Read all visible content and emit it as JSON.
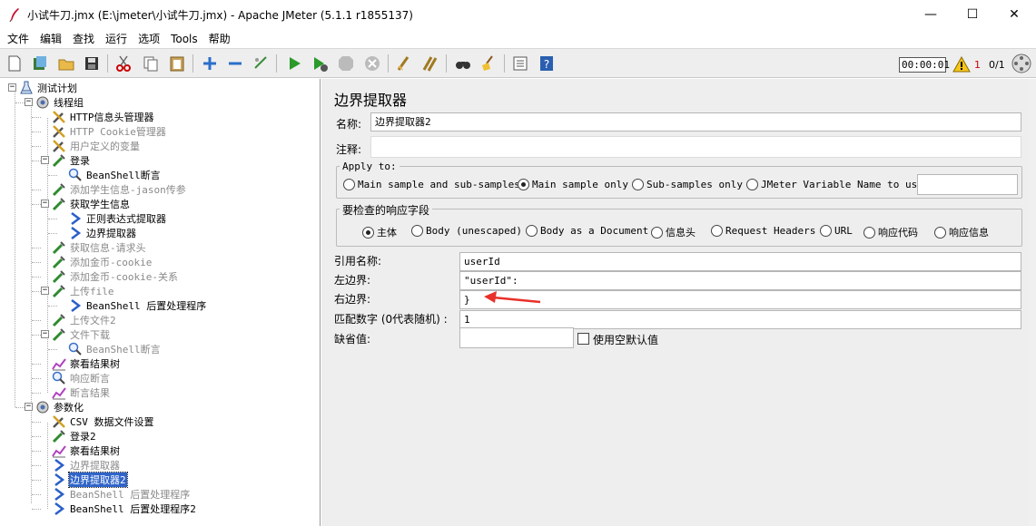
{
  "window": {
    "title": "小试牛刀.jmx (E:\\jmeter\\小试牛刀.jmx) - Apache JMeter (5.1.1 r1855137)",
    "minimize": "—",
    "maximize": "☐",
    "close": "✕"
  },
  "menu": [
    "文件",
    "编辑",
    "查找",
    "运行",
    "选项",
    "Tools",
    "帮助"
  ],
  "toolbar": {
    "timer": "00:00:01",
    "warning_count": "1",
    "thread_count": "0/1"
  },
  "tree": [
    {
      "label": "测试计划",
      "icon": "flask-icon",
      "depth": 0,
      "expanded": true
    },
    {
      "label": "线程组",
      "icon": "gear-icon",
      "depth": 1,
      "expanded": true
    },
    {
      "label": "HTTP信息头管理器",
      "icon": "wrench-icon",
      "depth": 2
    },
    {
      "label": "HTTP Cookie管理器",
      "icon": "wrench-icon",
      "depth": 2,
      "disabled": true
    },
    {
      "label": "用户定义的变量",
      "icon": "wrench-icon",
      "depth": 2,
      "disabled": true
    },
    {
      "label": "登录",
      "icon": "pipette-icon",
      "depth": 2,
      "expanded": true
    },
    {
      "label": "BeanShell断言",
      "icon": "magnifier-icon",
      "depth": 3
    },
    {
      "label": "添加学生信息-jason传参",
      "icon": "pipette-icon",
      "depth": 2,
      "disabled": true
    },
    {
      "label": "获取学生信息",
      "icon": "pipette-icon",
      "depth": 2,
      "expanded": true
    },
    {
      "label": "正则表达式提取器",
      "icon": "extractor-icon",
      "depth": 3
    },
    {
      "label": "边界提取器",
      "icon": "extractor-icon",
      "depth": 3
    },
    {
      "label": "获取信息-请求头",
      "icon": "pipette-icon",
      "depth": 2,
      "disabled": true
    },
    {
      "label": "添加金币-cookie",
      "icon": "pipette-icon",
      "depth": 2,
      "disabled": true
    },
    {
      "label": "添加金币-cookie-关系",
      "icon": "pipette-icon",
      "depth": 2,
      "disabled": true
    },
    {
      "label": "上传file",
      "icon": "pipette-icon",
      "depth": 2,
      "expanded": true,
      "disabled": true
    },
    {
      "label": "BeanShell 后置处理程序",
      "icon": "extractor-icon",
      "depth": 3
    },
    {
      "label": "上传文件2",
      "icon": "pipette-icon",
      "depth": 2,
      "disabled": true
    },
    {
      "label": "文件下载",
      "icon": "pipette-icon",
      "depth": 2,
      "expanded": true,
      "disabled": true
    },
    {
      "label": "BeanShell断言",
      "icon": "magnifier-icon",
      "depth": 3,
      "disabled": true
    },
    {
      "label": "察看结果树",
      "icon": "chart-icon",
      "depth": 2
    },
    {
      "label": "响应断言",
      "icon": "magnifier-icon",
      "depth": 2,
      "disabled": true
    },
    {
      "label": "断言结果",
      "icon": "chart-icon",
      "depth": 2,
      "disabled": true
    },
    {
      "label": "参数化",
      "icon": "gear-icon",
      "depth": 1,
      "expanded": true
    },
    {
      "label": "CSV 数据文件设置",
      "icon": "wrench-icon",
      "depth": 2
    },
    {
      "label": "登录2",
      "icon": "pipette-icon",
      "depth": 2
    },
    {
      "label": "察看结果树",
      "icon": "chart-icon",
      "depth": 2
    },
    {
      "label": "边界提取器",
      "icon": "extractor-icon",
      "depth": 2,
      "disabled": true
    },
    {
      "label": "边界提取器2",
      "icon": "extractor-icon",
      "depth": 2,
      "selected": true
    },
    {
      "label": "BeanShell 后置处理程序",
      "icon": "extractor-icon",
      "depth": 2,
      "disabled": true
    },
    {
      "label": "BeanShell 后置处理程序2",
      "icon": "extractor-icon",
      "depth": 2
    }
  ],
  "panel": {
    "title": "边界提取器",
    "name_label": "名称:",
    "name_value": "边界提取器2",
    "comment_label": "注释:",
    "comment_value": "",
    "apply_to": {
      "legend": "Apply to:",
      "options": [
        {
          "label": "Main sample and sub-samples",
          "selected": false
        },
        {
          "label": "Main sample only",
          "selected": true
        },
        {
          "label": "Sub-samples only",
          "selected": false
        },
        {
          "label": "JMeter Variable Name to use",
          "selected": false
        }
      ],
      "variable_value": ""
    },
    "field_to_check": {
      "legend": "要检查的响应字段",
      "options": [
        {
          "label": "主体",
          "selected": true
        },
        {
          "label": "Body (unescaped)",
          "selected": false
        },
        {
          "label": "Body as a Document",
          "selected": false
        },
        {
          "label": "信息头",
          "selected": false
        },
        {
          "label": "Request Headers",
          "selected": false
        },
        {
          "label": "URL",
          "selected": false
        },
        {
          "label": "响应代码",
          "selected": false
        },
        {
          "label": "响应信息",
          "selected": false
        }
      ]
    },
    "ref_name_label": "引用名称:",
    "ref_name_value": "userId",
    "left_label": "左边界:",
    "left_value": "\"userId\":",
    "right_label": "右边界:",
    "right_value": "}",
    "match_label": "匹配数字 (0代表随机) :",
    "match_value": "1",
    "default_label": "缺省值:",
    "default_value": "",
    "empty_default_label": "使用空默认值",
    "empty_default_checked": false
  },
  "colors": {
    "selection": "#2f64c9",
    "arrow": "#e8312a",
    "panel_bg": "#eeeeee"
  }
}
